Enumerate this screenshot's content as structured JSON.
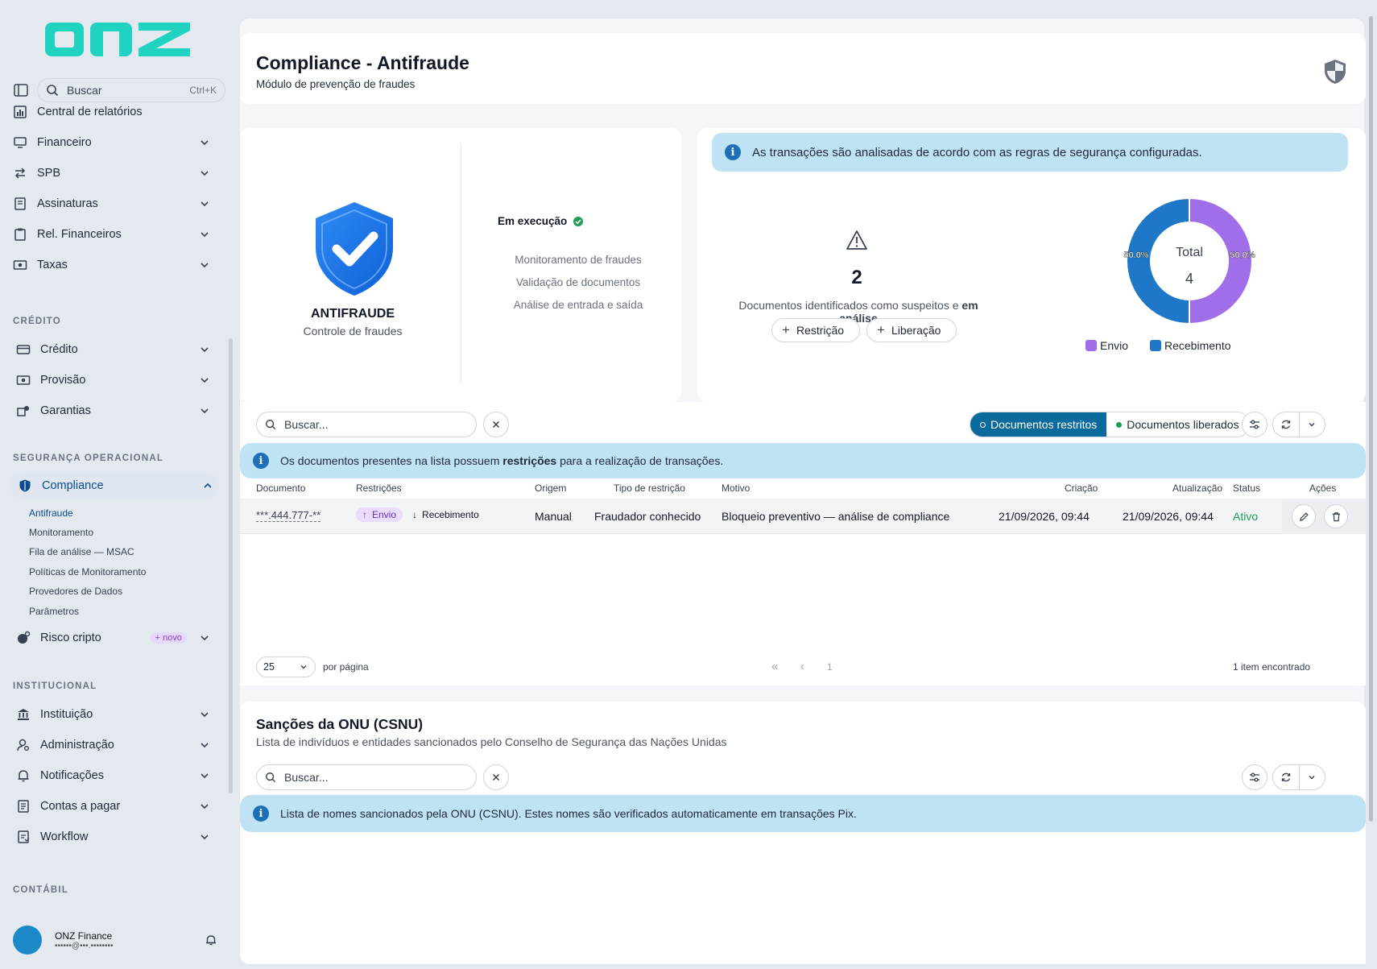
{
  "brand": {
    "logo_text": "onz",
    "color": "#1fd3c0"
  },
  "sidebar": {
    "search": {
      "label": "Buscar",
      "shortcut": "Ctrl+K"
    },
    "top_items": [
      {
        "label": "Central de relatórios"
      },
      {
        "label": "Financeiro"
      },
      {
        "label": "SPB"
      },
      {
        "label": "Assinaturas"
      },
      {
        "label": "Rel. Financeiros"
      },
      {
        "label": "Taxas"
      }
    ],
    "sections": {
      "credito": "CRÉDITO",
      "seguranca": "SEGURANÇA OPERACIONAL",
      "institucional": "INSTITUCIONAL",
      "contabil": "CONTÁBIL"
    },
    "credito_items": [
      {
        "label": "Crédito"
      },
      {
        "label": "Provisão"
      },
      {
        "label": "Garantias"
      }
    ],
    "compliance": {
      "label": "Compliance",
      "sub_items": [
        {
          "label": "Antifraude"
        },
        {
          "label": "Monitoramento"
        },
        {
          "label": "Fila de análise — MSAC"
        },
        {
          "label": "Políticas de Monitoramento"
        },
        {
          "label": "Provedores de Dados"
        },
        {
          "label": "Parâmetros"
        }
      ]
    },
    "risco": {
      "label": "Risco cripto",
      "badge": "+ novo"
    },
    "institucional_items": [
      {
        "label": "Instituição"
      },
      {
        "label": "Administração"
      },
      {
        "label": "Notificações"
      },
      {
        "label": "Contas a pagar"
      },
      {
        "label": "Workflow"
      }
    ],
    "user": {
      "name": "ONZ Finance",
      "email": "••••••@•••.••••••••"
    }
  },
  "header": {
    "title": "Compliance - Antifraude",
    "subtitle": "Módulo de prevenção de fraudes"
  },
  "antifraude": {
    "title": "ANTIFRAUDE",
    "subtitle": "Controle de fraudes",
    "status": "Em execução",
    "features": [
      "Monitoramento de fraudes",
      "Validação de documentos",
      "Análise de entrada e saída"
    ]
  },
  "summary": {
    "banner": "As transações são analisadas de acordo com as regras de segurança configuradas.",
    "count": "2",
    "desc_prefix": "Documentos identificados como suspeitos e ",
    "desc_bold": "em análise",
    "btn_restricao": "Restrição",
    "btn_liberacao": "Liberação"
  },
  "chart_data": {
    "type": "pie",
    "center_label": "Total",
    "center_value": "4",
    "categories": [
      "Envio",
      "Recebimento"
    ],
    "values": [
      50.0,
      50.0
    ],
    "value_labels": [
      "50.0%",
      "50.0%"
    ],
    "colors": [
      "#a06ee8",
      "#1f78c7"
    ],
    "legend_position": "bottom"
  },
  "documents": {
    "search_placeholder": "Buscar...",
    "tab_restritos": "Documentos restritos",
    "tab_liberados": "Documentos liberados",
    "banner_prefix": "Os documentos presentes na lista possuem ",
    "banner_bold": "restrições",
    "banner_suffix": " para a realização de transações.",
    "columns": [
      "Documento",
      "Restrições",
      "Origem",
      "Tipo de restrição",
      "Motivo",
      "Criação",
      "Atualização",
      "Status",
      "Ações"
    ],
    "rows": [
      {
        "documento": "***.444.777-**",
        "restricao_envio": "Envio",
        "restricao_recebimento": "Recebimento",
        "origem": "Manual",
        "tipo": "Fraudador conhecido",
        "motivo": "Bloqueio preventivo — análise de compliance",
        "criacao": "21/09/2026, 09:44",
        "atualizacao": "21/09/2026, 09:44",
        "status": "Ativo"
      }
    ],
    "page_size": "25",
    "per_page": "por página",
    "page": "1",
    "found": "1 item encontrado"
  },
  "sanctions": {
    "title": "Sanções da ONU (CSNU)",
    "subtitle": "Lista de indivíduos e entidades sancionados pelo Conselho de Segurança das Nações Unidas",
    "search_placeholder": "Buscar...",
    "banner": "Lista de nomes sancionados pela ONU (CSNU). Estes nomes são verificados automaticamente em transações Pix."
  },
  "colors": {
    "accent": "#0b6a9c",
    "status_ok": "#1f9d55",
    "info_bg": "#bfe2f5"
  }
}
